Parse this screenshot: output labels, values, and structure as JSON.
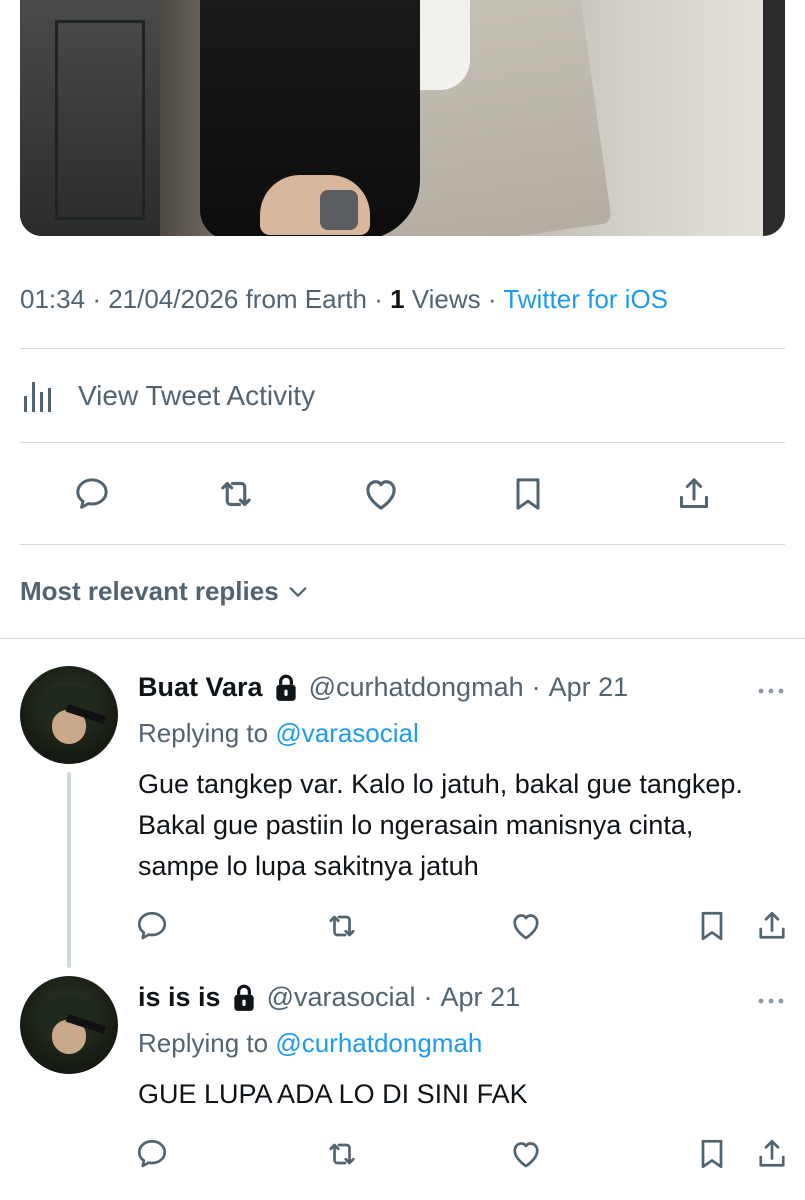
{
  "tweet": {
    "time": "01:34",
    "date": "21/04/2026",
    "location": "from Earth",
    "views_count": "1",
    "views_label": "Views",
    "source": "Twitter for iOS"
  },
  "activity": {
    "label": "View Tweet Activity"
  },
  "replies_section": {
    "label": "Most relevant replies"
  },
  "replies": [
    {
      "name": "Buat Vara",
      "handle": "@curhatdongmah",
      "date": "Apr 21",
      "replying_to_label": "Replying to",
      "replying_to": "@varasocial",
      "text": "Gue tangkep var. Kalo lo jatuh, bakal gue tangkep. Bakal gue pastiin lo ngerasain manisnya cinta, sampe lo lupa sakitnya jatuh"
    },
    {
      "name": "is is is",
      "handle": "@varasocial",
      "date": "Apr 21",
      "replying_to_label": "Replying to",
      "replying_to": "@curhatdongmah",
      "text": "GUE LUPA ADA LO DI SINI FAK"
    }
  ],
  "colors": {
    "accent": "#1d9bf0",
    "secondary_text": "#536471",
    "primary_text": "#0f1419",
    "divider": "#cfd9de"
  }
}
